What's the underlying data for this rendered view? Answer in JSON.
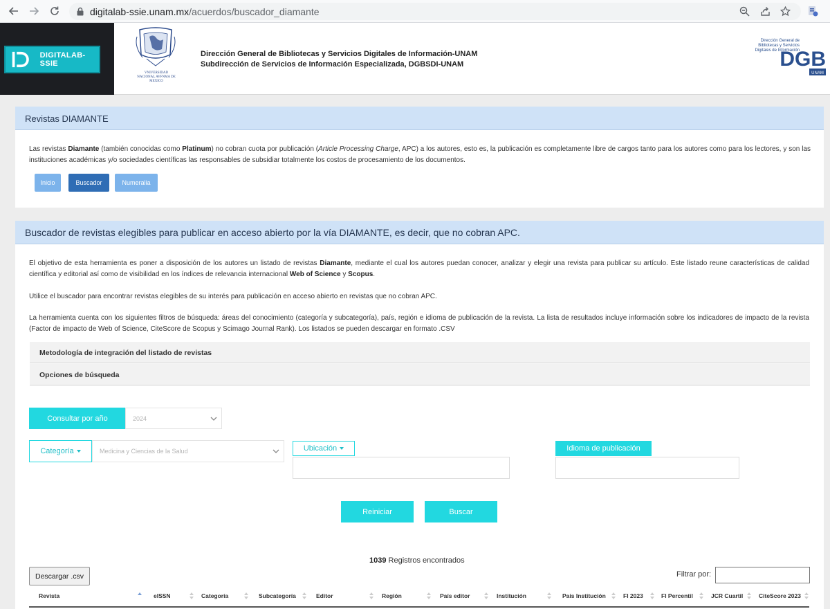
{
  "browser": {
    "url_host": "digitalab-ssie.unam.mx",
    "url_path": "/acuerdos/buscador_diamante"
  },
  "header": {
    "brand_name": "DIGITALAB-SSIE",
    "crest_caption": "VNIVERSIDAD NACIONAL AVFNMA DE MEXICO",
    "line1": "Dirección General de Bibliotecas y Servicios Digitales de Información-UNAM",
    "line2": "Subdirección de Servicios de Información Especializada, DGBSDI-UNAM",
    "dgb_text": "Dirección General de Bibliotecas y Servicios Digitales de Información",
    "dgb_unam": "UNAM",
    "dgb_letters": "DGB"
  },
  "intro": {
    "title": "Revistas DIAMANTE",
    "p_1": "Las revistas ",
    "p_2": "Diamante",
    "p_3": " (también conocidas como ",
    "p_4": "Platinum",
    "p_5": ") no cobran cuota por publicación (",
    "p_6": "Article Processing Charge",
    "p_7": ", APC) a los autores, esto es, la publicación es completamente libre de cargos tanto para los autores como para los lectores, y son las instituciones académicas y/o sociedades científicas las responsables de subsidiar totalmente los costos de procesamiento de los documentos.",
    "buttons": [
      "Inicio",
      "Buscador",
      "Numeralia"
    ]
  },
  "search": {
    "title": "Buscador de revistas elegibles para publicar en acceso abierto por la vía DIAMANTE, es decir, que no cobran APC.",
    "p1_1": "El objetivo de esta herramienta es poner a disposición de los autores un listado de revistas ",
    "p1_2": "Diamante",
    "p1_3": ", mediante el cual los autores puedan conocer, analizar y elegir una revista para publicar su artículo. Este listado reune características de calidad científica y editorial así como de visibilidad en los índices de relevancia internacional ",
    "p1_4": "Web of Science",
    "p1_5": " y ",
    "p1_6": "Scopus",
    "p1_7": ".",
    "p2": "Utilice el buscador para encontrar revistas elegibles de su interés para publicación en acceso abierto en revistas que no cobran APC.",
    "p3": "La herramienta cuenta con los siguientes filtros de búsqueda: áreas del conocimiento (categoría y subcategoría), país, región e idioma de publicación de la revista. La lista de resultados incluye información sobre los indicadores de impacto de la revista (Factor de impacto de Web of Science, CiteScore de Scopus y Scimago Journal Rank). Los listados se pueden descargar en formato .CSV",
    "accordion": [
      "Metodología de integración del listado de revistas",
      "Opciones de búsqueda"
    ]
  },
  "filters": {
    "year_button": "Consultar por año",
    "year_value": "2024",
    "category_button": "Categoría",
    "category_value": "Medicina y Ciencias de la Salud",
    "location_button": "Ubicación",
    "language_button": "Idioma de publicación",
    "reset": "Reiniciar",
    "search": "Buscar"
  },
  "results": {
    "count": "1039",
    "count_label": " Registros encontrados",
    "download": "Descargar .csv",
    "filter_label": "Filtrar por:",
    "columns": [
      "Revista",
      "eISSN",
      "Categoría",
      "Subcategoría",
      "Editor",
      "Región",
      "País editor",
      "Institución",
      "País Institución",
      "FI 2023",
      "FI Percentil",
      "JCR Cuartil",
      "CiteScore 2023"
    ]
  },
  "colors": {
    "panel_header": "#cfe2f7",
    "teal": "#22d8e0",
    "active_tab": "#2f6db5",
    "inactive_tab": "#7cb3eb"
  }
}
